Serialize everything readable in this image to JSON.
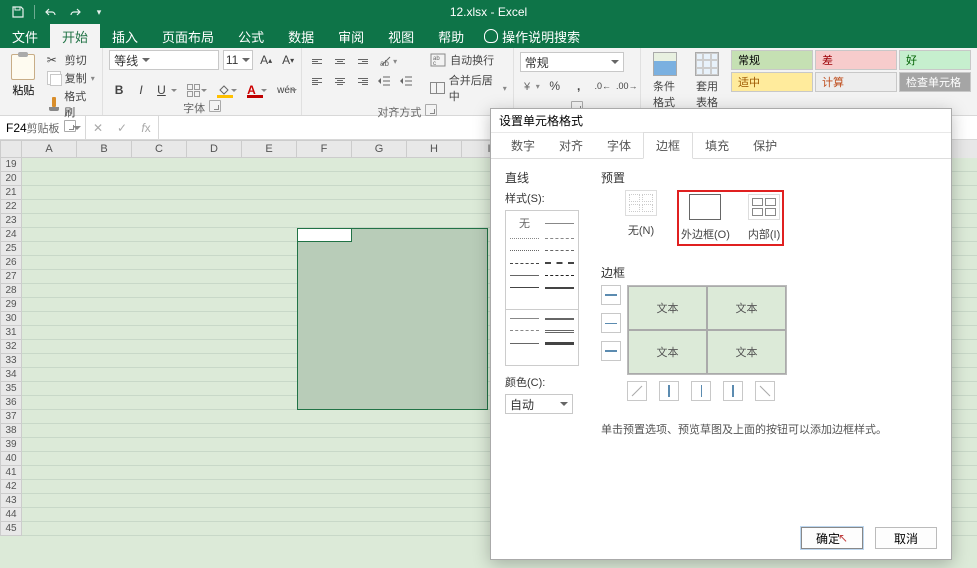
{
  "app": {
    "title": "12.xlsx  -  Excel"
  },
  "tabs": {
    "file": "文件",
    "home": "开始",
    "insert": "插入",
    "layout": "页面布局",
    "formula": "公式",
    "data": "数据",
    "review": "审阅",
    "view": "视图",
    "help": "帮助",
    "tellme": "操作说明搜索"
  },
  "clipboard": {
    "paste": "粘贴",
    "cut": "剪切",
    "copy": "复制",
    "painter": "格式刷",
    "group": "剪贴板"
  },
  "font": {
    "name": "等线",
    "size": "11",
    "group": "字体"
  },
  "align": {
    "group": "对齐方式",
    "wrap": "自动换行",
    "merge": "合并后居中"
  },
  "number": {
    "format": "常规"
  },
  "styles": {
    "cond": "条件格式",
    "table": "套用\n表格格式",
    "cells": [
      {
        "t": "常规",
        "bg": "#c5e0b3",
        "fg": "#444"
      },
      {
        "t": "差",
        "bg": "#f7cccc",
        "fg": "#9c0006"
      },
      {
        "t": "好",
        "bg": "#c6efce",
        "fg": "#006100"
      },
      {
        "t": "适中",
        "bg": "#ffeb9c",
        "fg": "#9c5700"
      },
      {
        "t": "计算",
        "bg": "#ededed",
        "fg": "#c05020"
      },
      {
        "t": "检查单元格",
        "bg": "#a5a5a5",
        "fg": "#fff"
      }
    ]
  },
  "namebox": "F24",
  "columns": [
    "A",
    "B",
    "C",
    "D",
    "E",
    "F",
    "G",
    "H",
    "I"
  ],
  "rows": [
    19,
    20,
    21,
    22,
    23,
    24,
    25,
    26,
    27,
    28,
    29,
    30,
    31,
    32,
    33,
    34,
    35,
    36,
    37,
    38,
    39,
    40,
    41,
    42,
    43,
    44,
    45
  ],
  "dialog": {
    "title": "设置单元格格式",
    "tabs": {
      "number": "数字",
      "align": "对齐",
      "font": "字体",
      "border": "边框",
      "fill": "填充",
      "protect": "保护"
    },
    "line": "直线",
    "style": "样式(S):",
    "none": "无",
    "color": "颜色(C):",
    "auto": "自动",
    "preset": "预置",
    "preset_none": "无(N)",
    "preset_outline": "外边框(O)",
    "preset_inside": "内部(I)",
    "border": "边框",
    "sample": "文本",
    "hint": "单击预置选项、预览草图及上面的按钮可以添加边框样式。",
    "ok": "确定",
    "cancel": "取消"
  }
}
